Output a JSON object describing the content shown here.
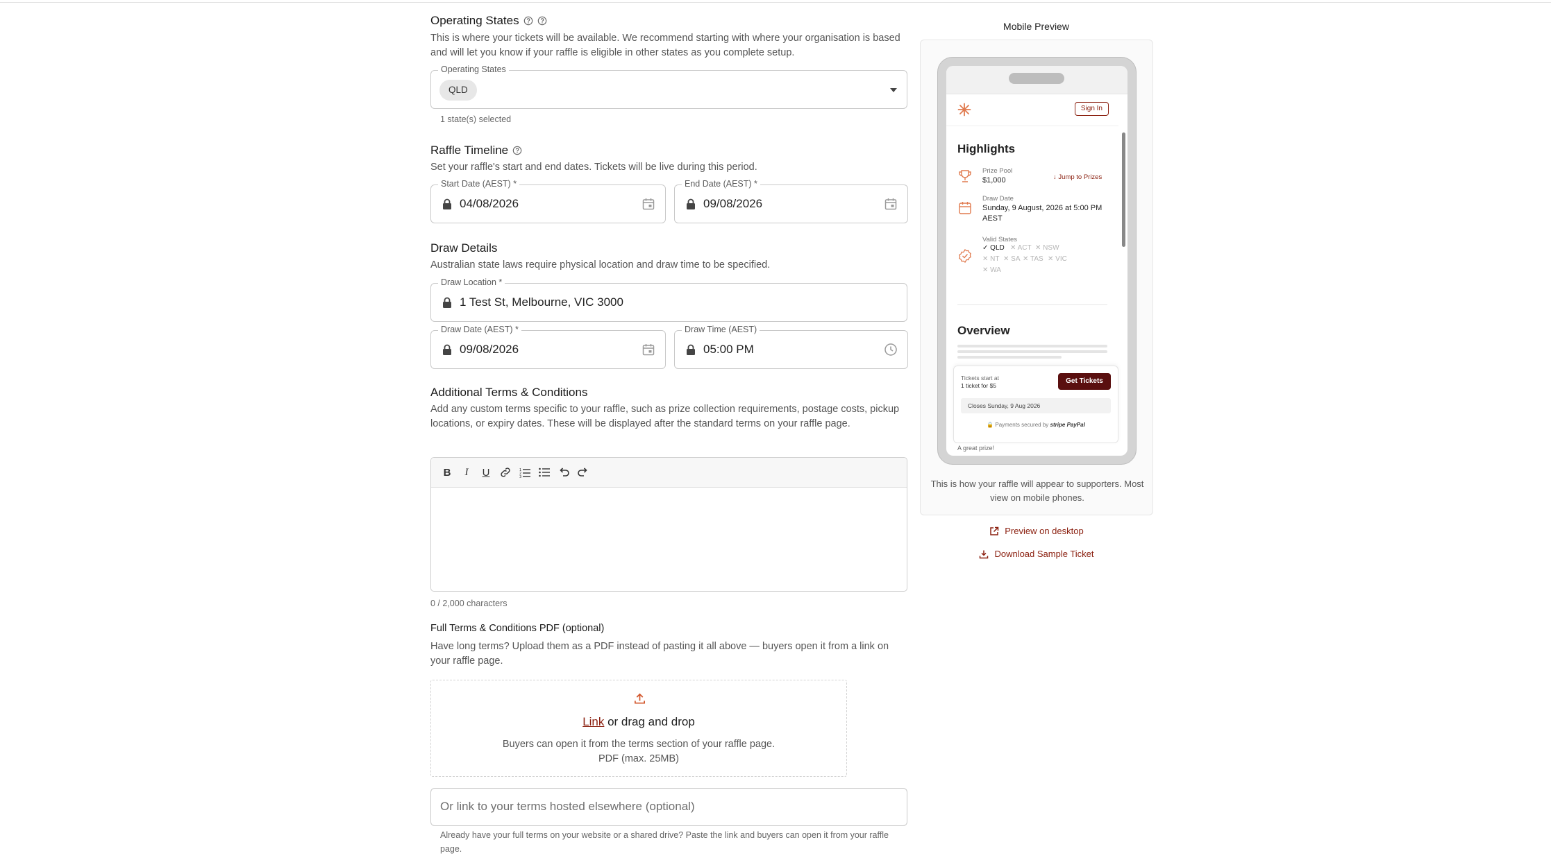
{
  "operating_states": {
    "title": "Operating States",
    "description": "This is where your tickets will be available. We recommend starting with where your organisation is based and will let you know if your raffle is eligible in other states as you complete setup.",
    "field_label": "Operating States",
    "selected_chip": "QLD",
    "count_text": "1 state(s) selected"
  },
  "timeline": {
    "title": "Raffle Timeline",
    "description": "Set your raffle's start and end dates. Tickets will be live during this period.",
    "start_label": "Start Date (AEST) *",
    "start_value": "04/08/2026",
    "end_label": "End Date (AEST) *",
    "end_value": "09/08/2026"
  },
  "draw": {
    "title": "Draw Details",
    "description": "Australian state laws require physical location and draw time to be specified.",
    "location_label": "Draw Location *",
    "location_value": "1 Test St, Melbourne, VIC 3000",
    "date_label": "Draw Date (AEST) *",
    "date_value": "09/08/2026",
    "time_label": "Draw Time (AEST)",
    "time_value": "05:00 PM"
  },
  "terms": {
    "title": "Additional Terms & Conditions",
    "description": "Add any custom terms specific to your raffle, such as prize collection requirements, postage costs, pickup locations, or expiry dates. These will be displayed after the standard terms on your raffle page.",
    "char_count": "0 / 2,000 characters",
    "toolbar": {
      "bold": "B",
      "italic": "I",
      "underline": "U"
    }
  },
  "pdf": {
    "title": "Full Terms & Conditions PDF (optional)",
    "description": "Have long terms? Upload them as a PDF instead of pasting it all above — buyers open it from a link on your raffle page.",
    "link_text": "Link",
    "drag_text": " or drag and drop",
    "sub_line1": "Buyers can open it from the terms section of your raffle page.",
    "sub_line2": "PDF (max. 25MB)",
    "url_placeholder": "Or link to your terms hosted elsewhere (optional)",
    "url_help": "Already have your full terms on your website or a shared drive? Paste the link and buyers can open it from your raffle page."
  },
  "preview": {
    "title": "Mobile Preview",
    "sign_in": "Sign In",
    "highlights": "Highlights",
    "prize_pool_label": "Prize Pool",
    "prize_pool_value": "$1,000",
    "jump": "Jump to Prizes",
    "draw_date_label": "Draw Date",
    "draw_date_value": "Sunday, 9 August, 2026 at 5:00 PM AEST",
    "valid_states_label": "Valid States",
    "states": [
      {
        "name": "QLD",
        "on": true
      },
      {
        "name": "ACT",
        "on": false
      },
      {
        "name": "NSW",
        "on": false
      },
      {
        "name": "NT",
        "on": false
      },
      {
        "name": "SA",
        "on": false
      },
      {
        "name": "TAS",
        "on": false
      },
      {
        "name": "VIC",
        "on": false
      },
      {
        "name": "WA",
        "on": false
      }
    ],
    "overview": "Overview",
    "tickets_start": "Tickets start at",
    "tickets_price": "1 ticket for $5",
    "get_tickets": "Get Tickets",
    "closes": "Closes Sunday, 9 Aug 2026",
    "secured": "Payments secured by",
    "stripe": "stripe",
    "paypal": "PayPal",
    "great_prize": "A great prize!",
    "caption": "This is how your raffle will appear to supporters. Most view on mobile phones.",
    "desktop_link": "Preview on desktop",
    "download_link": "Download Sample Ticket"
  },
  "colors": {
    "accent": "#8b2010",
    "button": "#5a0f0f",
    "icon_orange": "#e07a4e"
  }
}
